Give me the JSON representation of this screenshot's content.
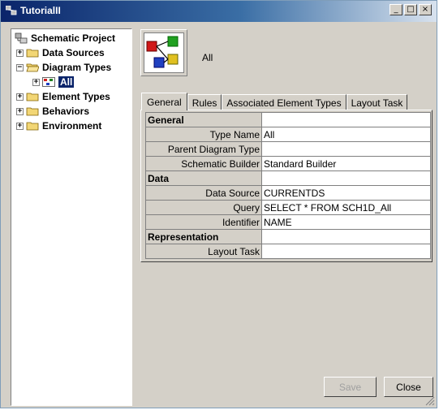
{
  "window": {
    "title": "TutorialII",
    "minimize": "_",
    "maximize": "□",
    "close": "×"
  },
  "tree": {
    "root": "Schematic Project",
    "items": [
      {
        "label": "Data Sources",
        "expander": "+"
      },
      {
        "label": "Diagram Types",
        "expander": "−"
      },
      {
        "label": "All",
        "expander": "+"
      },
      {
        "label": "Element Types",
        "expander": "+"
      },
      {
        "label": "Behaviors",
        "expander": "+"
      },
      {
        "label": "Environment",
        "expander": "+"
      }
    ]
  },
  "header": {
    "label": "All"
  },
  "tabs": [
    {
      "label": "General"
    },
    {
      "label": "Rules"
    },
    {
      "label": "Associated Element Types"
    },
    {
      "label": "Layout Task"
    }
  ],
  "grid": {
    "sections": [
      {
        "title": "General",
        "rows": [
          {
            "key": "Type Name",
            "value": "All"
          },
          {
            "key": "Parent Diagram Type",
            "value": ""
          },
          {
            "key": "Schematic Builder",
            "value": "Standard Builder"
          }
        ]
      },
      {
        "title": "Data",
        "rows": [
          {
            "key": "Data Source",
            "value": "CURRENTDS"
          },
          {
            "key": "Query",
            "value": "SELECT * FROM SCH1D_All"
          },
          {
            "key": "Identifier",
            "value": "NAME"
          }
        ]
      },
      {
        "title": "Representation",
        "rows": [
          {
            "key": "Layout Task",
            "value": ""
          }
        ]
      }
    ]
  },
  "buttons": {
    "save": "Save",
    "close": "Close"
  }
}
